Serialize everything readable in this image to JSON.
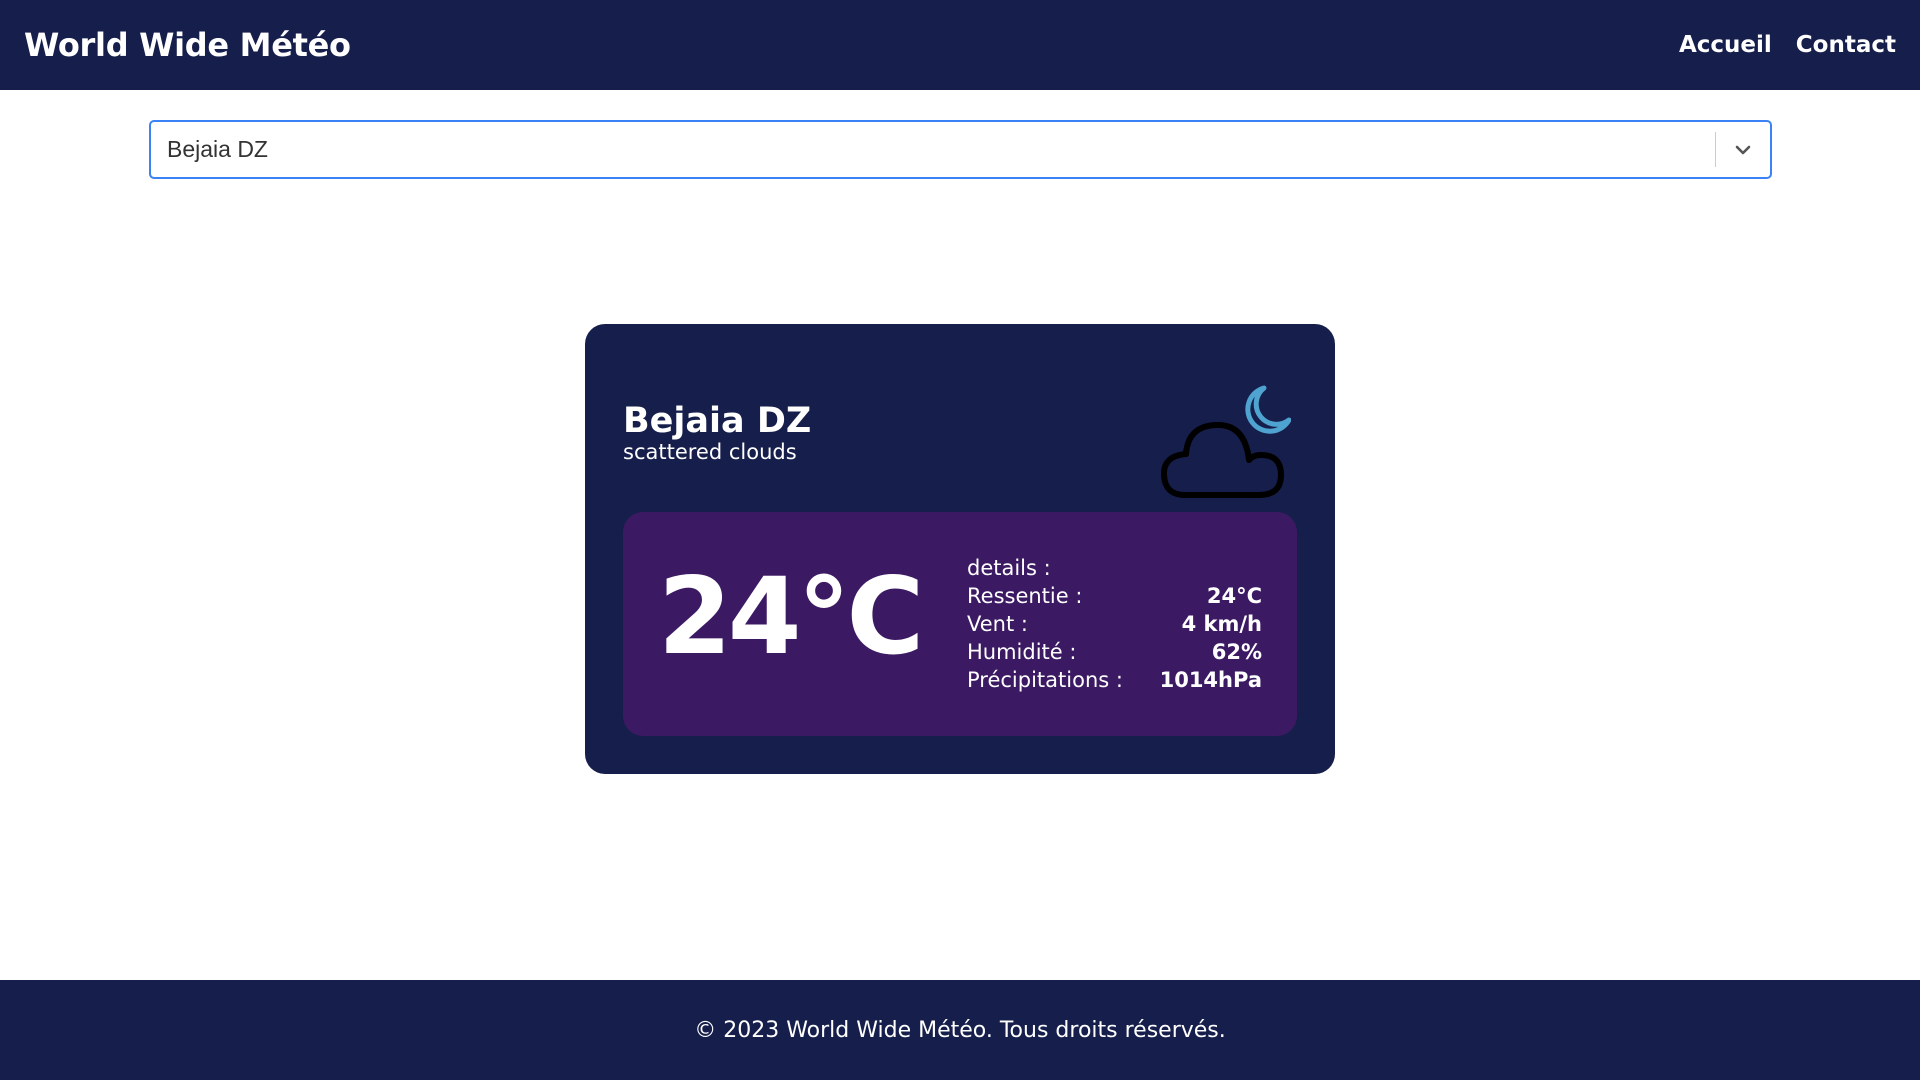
{
  "header": {
    "brand": "World Wide Météo",
    "nav": [
      {
        "label": "Accueil"
      },
      {
        "label": "Contact"
      }
    ]
  },
  "search": {
    "selected_value": "Bejaia DZ"
  },
  "weather": {
    "city": "Bejaia DZ",
    "description": "scattered clouds",
    "icon": "cloud-moon-icon",
    "temperature": "24°C",
    "details_title": "details :",
    "details": [
      {
        "label": "Ressentie :",
        "value": "24°C"
      },
      {
        "label": "Vent :",
        "value": "4 km/h"
      },
      {
        "label": "Humidité :",
        "value": "62%"
      },
      {
        "label": "Précipitations :",
        "value": "1014hPa"
      }
    ]
  },
  "footer": {
    "text": "© 2023 World Wide Météo. Tous droits réservés."
  },
  "colors": {
    "navy": "#161e4b",
    "purple": "#3c1a63",
    "moon": "#4fa3d1",
    "focus_border": "#3b82f6"
  }
}
